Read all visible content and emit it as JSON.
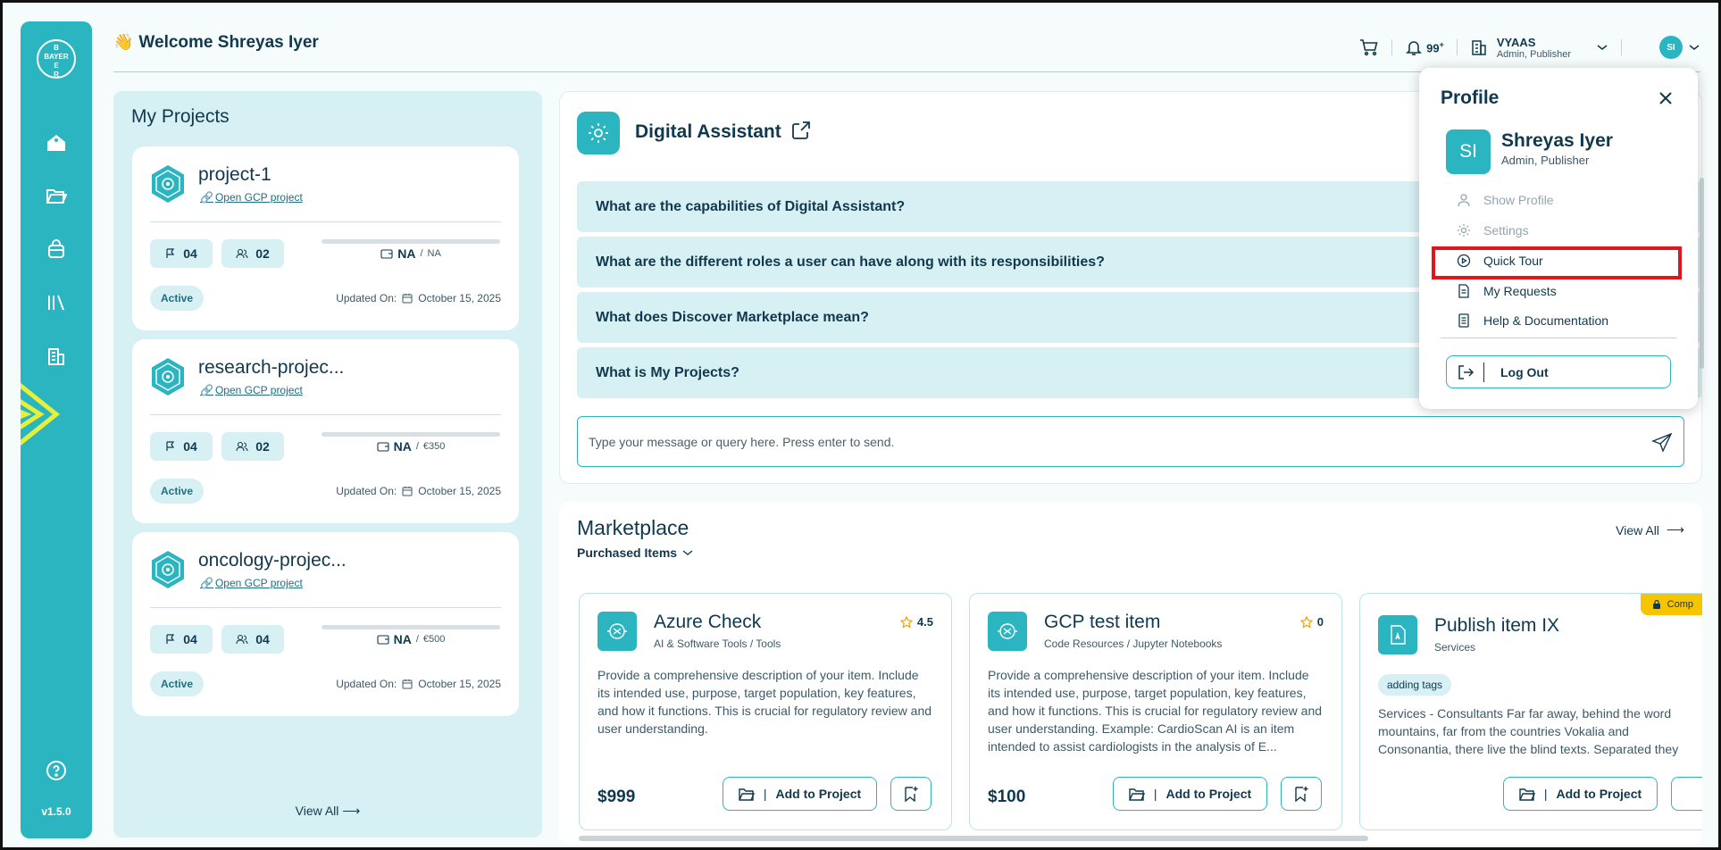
{
  "header": {
    "welcome": "Welcome Shreyas Iyer",
    "wave_emoji": "👋",
    "notifications_count": "99",
    "notifications_plus": "+",
    "org_name": "VYAAS",
    "org_role": "Admin, Publisher",
    "avatar_initials": "SI"
  },
  "sidebar": {
    "logo_lines": [
      "B",
      "BAYER",
      "E",
      "R"
    ],
    "version": "v1.5.0"
  },
  "projects": {
    "title": "My Projects",
    "updated_label": "Updated On:",
    "view_all": "View All",
    "items": [
      {
        "name": "project-1",
        "link": "Open GCP project",
        "flags": "04",
        "members": "02",
        "budget_main": "NA",
        "budget_sub": "NA",
        "status": "Active",
        "updated": "October 15, 2025"
      },
      {
        "name": "research-projec...",
        "link": "Open GCP project",
        "flags": "04",
        "members": "02",
        "budget_main": "NA",
        "budget_sub": "€350",
        "status": "Active",
        "updated": "October 15, 2025"
      },
      {
        "name": "oncology-projec...",
        "link": "Open GCP project",
        "flags": "04",
        "members": "04",
        "budget_main": "NA",
        "budget_sub": "€500",
        "status": "Active",
        "updated": "October 15, 2025"
      }
    ]
  },
  "assistant": {
    "title": "Digital Assistant",
    "faqs": [
      "What are the capabilities of Digital Assistant?",
      "What are the different roles a user can have along with its responsibilities?",
      "What does Discover Marketplace mean?",
      "What is My Projects?"
    ],
    "input_placeholder": "Type your message or query here. Press enter to send."
  },
  "marketplace": {
    "title": "Marketplace",
    "filter": "Purchased Items",
    "view_all": "View All",
    "add_label": "Add to Project",
    "items": [
      {
        "name": "Azure Check",
        "category": "AI & Software Tools / Tools",
        "rating": "4.5",
        "description": "Provide a comprehensive description of your item. Include its intended use, purpose, target population, key features, and how it functions. This is crucial for regulatory review and user understanding.",
        "price": "$999"
      },
      {
        "name": "GCP test item",
        "category": "Code Resources / Jupyter Notebooks",
        "rating": "0",
        "description": "Provide a comprehensive description of your item. Include its intended use, purpose, target population, key features, and how it functions. This is crucial for regulatory review and user understanding. Example: CardioScan AI is an item intended to assist cardiologists in the analysis of E...",
        "price": "$100"
      },
      {
        "name": "Publish item IX",
        "category": "Services",
        "badge": "Comp",
        "tag": "adding tags",
        "description": "Services - Consultants Far far away, behind the word mountains, far from the countries Vokalia and Consonantia, there live the blind texts. Separated they"
      }
    ]
  },
  "profile": {
    "title": "Profile",
    "initials": "SI",
    "name": "Shreyas Iyer",
    "role": "Admin, Publisher",
    "menu": [
      "Show Profile",
      "Settings",
      "Quick Tour",
      "My Requests",
      "Help & Documentation"
    ],
    "logout": "Log Out"
  },
  "colors": {
    "accent": "#2bb5c0",
    "light_accent": "#d7f0f3",
    "text": "#10384f",
    "highlight": "#e0161b",
    "badge": "#f7c400"
  }
}
